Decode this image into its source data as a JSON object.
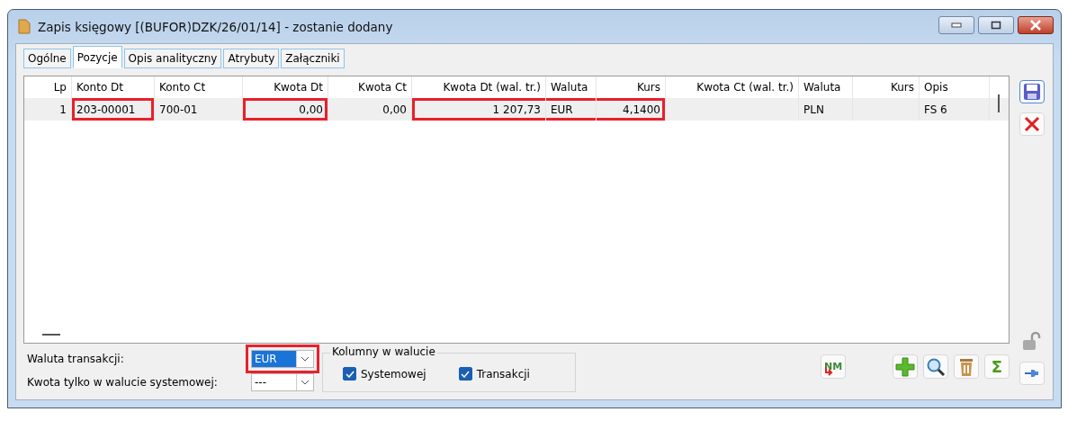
{
  "window": {
    "title": "Zapis księgowy [(BUFOR)DZK/26/01/14] - zostanie dodany"
  },
  "tabs": [
    {
      "label": "Ogólne",
      "selected": false
    },
    {
      "label": "Pozycje",
      "selected": true
    },
    {
      "label": "Opis analityczny",
      "selected": false
    },
    {
      "label": "Atrybuty",
      "selected": false
    },
    {
      "label": "Załączniki",
      "selected": false
    }
  ],
  "table": {
    "columns": [
      {
        "label": "Lp",
        "numeric": true
      },
      {
        "label": "Konto Dt",
        "numeric": false
      },
      {
        "label": "Konto Ct",
        "numeric": false
      },
      {
        "label": "Kwota Dt",
        "numeric": true
      },
      {
        "label": "Kwota Ct",
        "numeric": true
      },
      {
        "label": "Kwota Dt (wal. tr.)",
        "numeric": true
      },
      {
        "label": "Waluta",
        "numeric": false
      },
      {
        "label": "Kurs",
        "numeric": true
      },
      {
        "label": "Kwota Ct (wal. tr.)",
        "numeric": true
      },
      {
        "label": "Waluta",
        "numeric": false
      },
      {
        "label": "Kurs",
        "numeric": true
      },
      {
        "label": "Opis",
        "numeric": false
      }
    ],
    "rows": [
      {
        "cells": [
          {
            "text": "1",
            "highlighted": false
          },
          {
            "text": "203-00001",
            "highlighted": true
          },
          {
            "text": "700-01",
            "highlighted": false
          },
          {
            "text": "0,00",
            "highlighted": true
          },
          {
            "text": "0,00",
            "highlighted": false
          },
          {
            "text": "1 207,73",
            "highlighted": true
          },
          {
            "text": "EUR",
            "highlighted": true
          },
          {
            "text": "4,1400",
            "highlighted": true
          },
          {
            "text": "",
            "highlighted": false
          },
          {
            "text": "PLN",
            "highlighted": false
          },
          {
            "text": "",
            "highlighted": false
          },
          {
            "text": "FS 6",
            "highlighted": false
          }
        ]
      }
    ]
  },
  "fields": [
    {
      "label": "Waluta transakcji:",
      "value": "EUR",
      "highlighted": true
    },
    {
      "label": "Kwota tylko w walucie systemowej:",
      "value": "---",
      "highlighted": false
    }
  ],
  "currency_columns": {
    "title": "Kolumny w walucie",
    "options": [
      {
        "label": "Systemowej",
        "checked": true
      },
      {
        "label": "Transakcji",
        "checked": true
      }
    ]
  },
  "toolbar": {
    "nm_label": "NM",
    "sum_label": "Σ"
  }
}
